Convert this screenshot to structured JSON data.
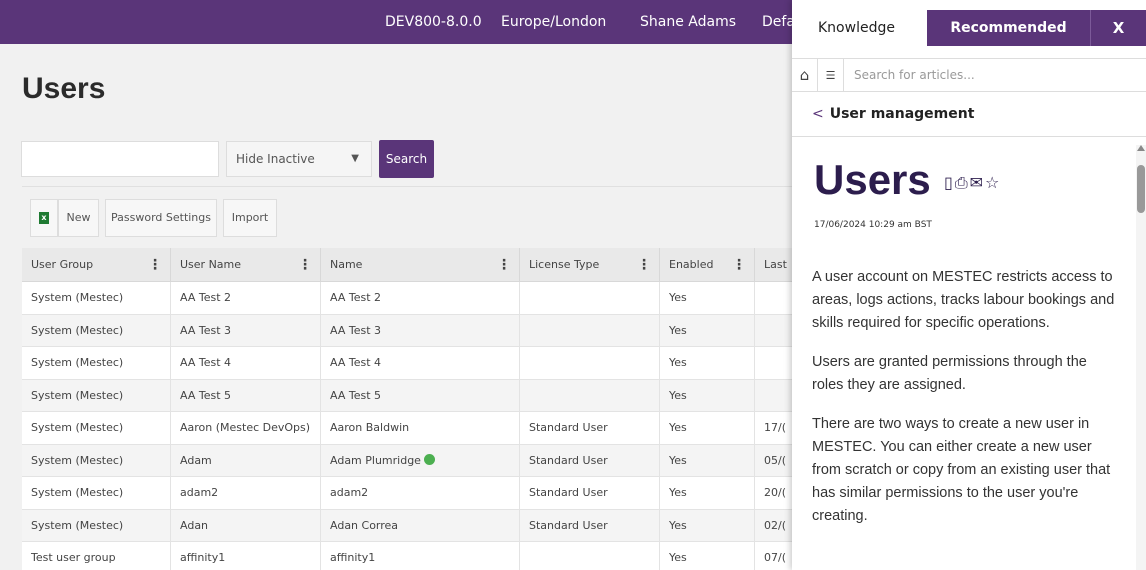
{
  "topbar": {
    "environment": "DEV800-8.0.0",
    "timezone": "Europe/London",
    "user": "Shane Adams",
    "partial": "Defa"
  },
  "page": {
    "title": "Users"
  },
  "filters": {
    "search_value": "",
    "status_select": "Hide Inactive",
    "search_button": "Search"
  },
  "toolbar": {
    "export_icon": "excel-icon",
    "new_label": "New",
    "password_label": "Password Settings",
    "import_label": "Import"
  },
  "table": {
    "headers": [
      "User Group",
      "User Name",
      "Name",
      "License Type",
      "Enabled",
      "Last"
    ],
    "rows": [
      [
        "System (Mestec)",
        "AA Test 2",
        "AA Test 2",
        "",
        "Yes",
        ""
      ],
      [
        "System (Mestec)",
        "AA Test 3",
        "AA Test 3",
        "",
        "Yes",
        ""
      ],
      [
        "System (Mestec)",
        "AA Test 4",
        "AA Test 4",
        "",
        "Yes",
        ""
      ],
      [
        "System (Mestec)",
        "AA Test 5",
        "AA Test 5",
        "",
        "Yes",
        ""
      ],
      [
        "System (Mestec)",
        "Aaron (Mestec DevOps)",
        "Aaron Baldwin",
        "Standard User",
        "Yes",
        "17/("
      ],
      [
        "System (Mestec)",
        "Adam",
        "Adam Plumridge",
        "Standard User",
        "Yes",
        "05/("
      ],
      [
        "System (Mestec)",
        "adam2",
        "adam2",
        "Standard User",
        "Yes",
        "20/("
      ],
      [
        "System (Mestec)",
        "Adan",
        "Adan Correa",
        "Standard User",
        "Yes",
        "02/("
      ],
      [
        "Test user group",
        "affinity1",
        "affinity1",
        "",
        "Yes",
        "07/("
      ]
    ]
  },
  "knowledge": {
    "tab_knowledge": "Knowledge",
    "tab_recommended": "Recommended",
    "close_label": "X",
    "search_placeholder": "Search for articles...",
    "breadcrumb": "User management",
    "article_title": "Users",
    "article_date": "17/06/2024 10:29 am BST",
    "paragraphs": [
      "A user account on MESTEC restricts access to areas, logs actions, tracks labour bookings and skills required for specific operations.",
      "Users are granted permissions through the roles they are assigned.",
      "There are two ways to create a new user in MESTEC. You can either create a new user from scratch or copy from an existing user that has similar permissions to the user you're creating."
    ]
  },
  "colors": {
    "brand": "#5a3579",
    "title_dark": "#2c1d4d"
  }
}
